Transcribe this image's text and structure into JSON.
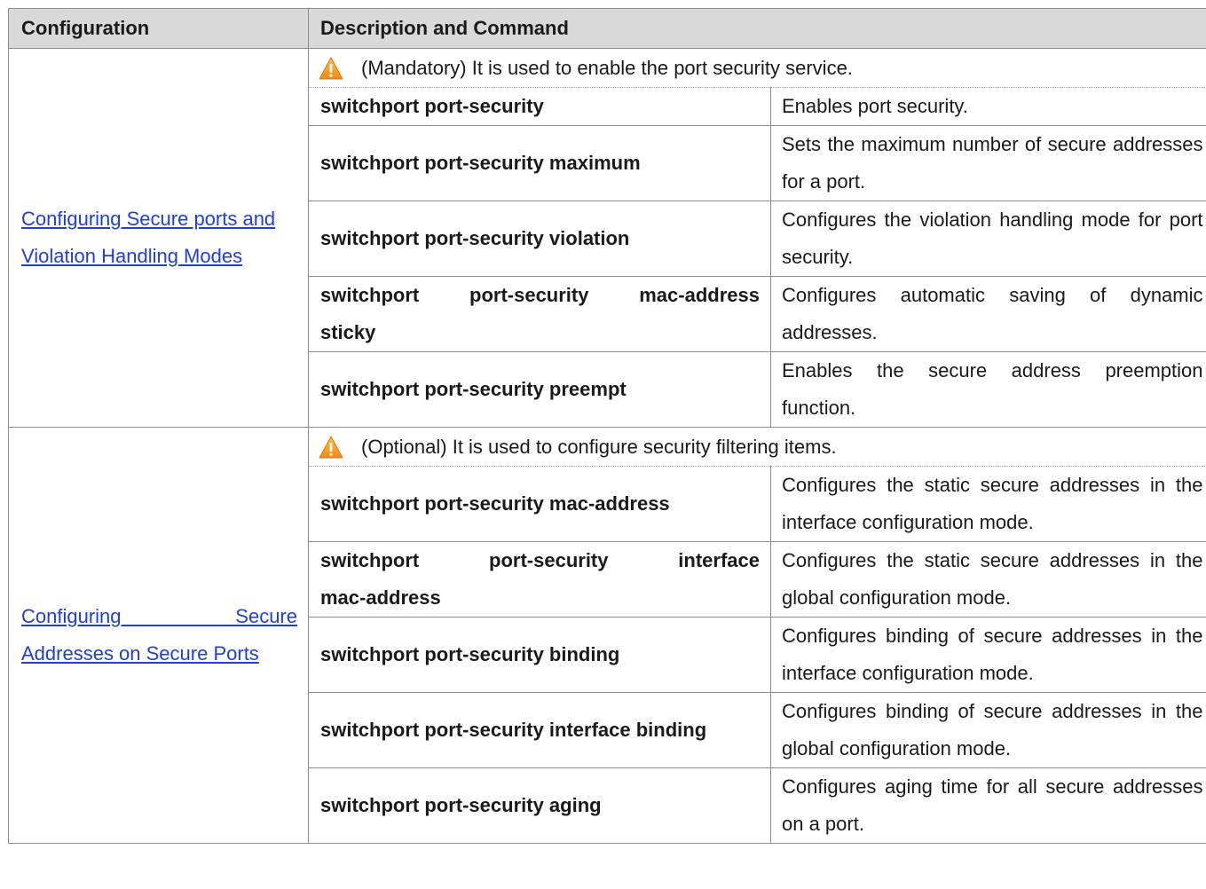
{
  "header": {
    "col1": "Configuration",
    "col2": "Description and Command"
  },
  "sections": [
    {
      "config_line1": "Configuring Secure ports and",
      "config_line2": "Violation Handling Modes",
      "note": "(Mandatory) It is used to enable the port security service.",
      "rows": [
        {
          "cmd": "switchport port-security",
          "desc": "Enables port security."
        },
        {
          "cmd": "switchport port-security maximum",
          "desc": "Sets the maximum number of secure addresses for a port."
        },
        {
          "cmd": "switchport port-security violation",
          "desc": "Configures the violation handling mode for port security."
        },
        {
          "cmd_line1": "switchport port-security mac-address",
          "cmd_line2": "sticky",
          "desc": "Configures automatic saving of dynamic addresses."
        },
        {
          "cmd": "switchport port-security preempt",
          "desc": "Enables the secure address preemption function."
        }
      ]
    },
    {
      "config_line1": "Configuring Secure",
      "config_line2": "Addresses on Secure Ports",
      "note": "(Optional) It is used to configure security filtering items.",
      "rows": [
        {
          "cmd": "switchport port-security mac-address",
          "desc": "Configures the static secure addresses in the interface configuration mode."
        },
        {
          "cmd_line1": "switchport port-security interface",
          "cmd_line2": "mac-address",
          "desc": "Configures the static secure addresses in the global configuration mode."
        },
        {
          "cmd": "switchport port-security binding",
          "desc": "Configures binding of secure addresses in the interface configuration mode."
        },
        {
          "cmd": "switchport port-security interface binding",
          "desc": "Configures binding of secure addresses in the global configuration mode."
        },
        {
          "cmd": "switchport port-security aging",
          "desc": "Configures aging time for all secure addresses on a port."
        }
      ]
    }
  ],
  "icons": {
    "warning": "warning-triangle-icon"
  },
  "colors": {
    "header_bg": "#d9d9d9",
    "link": "#1f3fd6",
    "warning": "#f39a1e"
  }
}
